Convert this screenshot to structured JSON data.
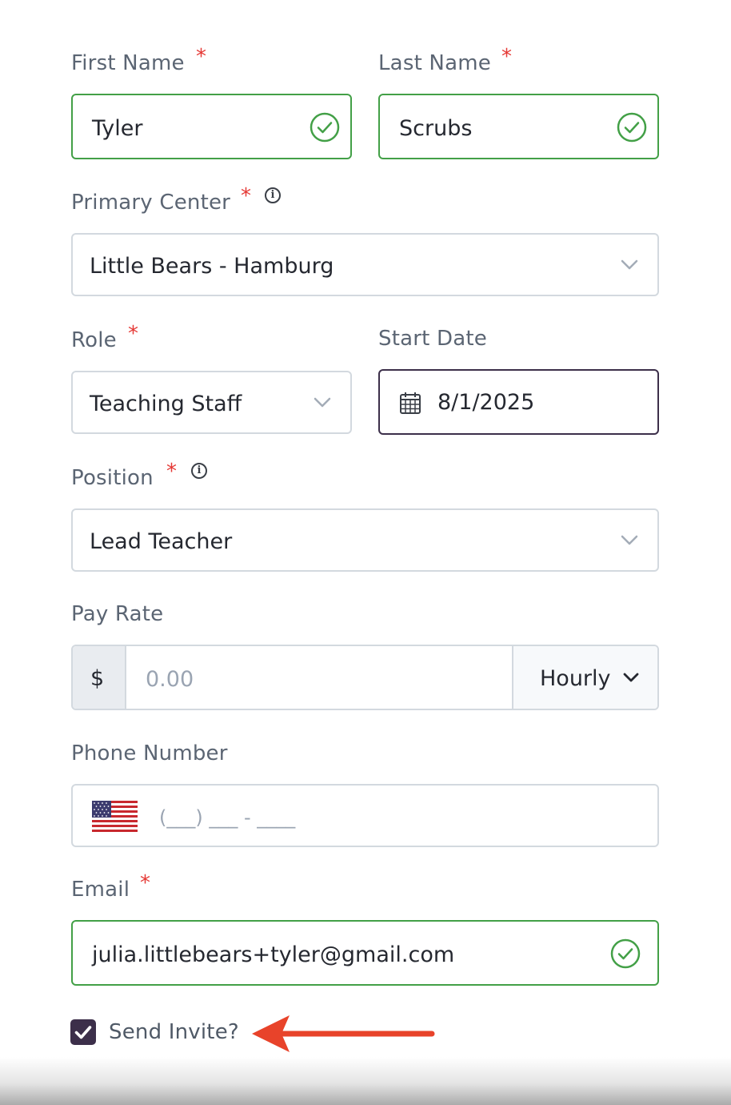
{
  "form": {
    "first_name": {
      "label": "First Name",
      "required_mark": "*",
      "value": "Tyler"
    },
    "last_name": {
      "label": "Last Name",
      "required_mark": "*",
      "value": "Scrubs"
    },
    "primary_center": {
      "label": "Primary Center",
      "required_mark": "*",
      "info_mark": "i",
      "value": "Little Bears - Hamburg"
    },
    "role": {
      "label": "Role",
      "required_mark": "*",
      "value": "Teaching Staff"
    },
    "start_date": {
      "label": "Start Date",
      "value": "8/1/2025"
    },
    "position": {
      "label": "Position",
      "required_mark": "*",
      "info_mark": "i",
      "value": "Lead Teacher"
    },
    "pay_rate": {
      "label": "Pay Rate",
      "currency_symbol": "$",
      "placeholder": "0.00",
      "period": "Hourly"
    },
    "phone_number": {
      "label": "Phone Number",
      "placeholder": "(___) ___ - ____",
      "country_flag": "us-flag-icon"
    },
    "email": {
      "label": "Email",
      "required_mark": "*",
      "value": "julia.littlebears+tyler@gmail.com"
    },
    "send_invite": {
      "label": "Send Invite?",
      "checked": true
    }
  },
  "colors": {
    "valid_border": "#43a047",
    "required_star": "#e53935",
    "checkbox_fill": "#3c2f4a",
    "annotation_arrow": "#e8432a"
  }
}
